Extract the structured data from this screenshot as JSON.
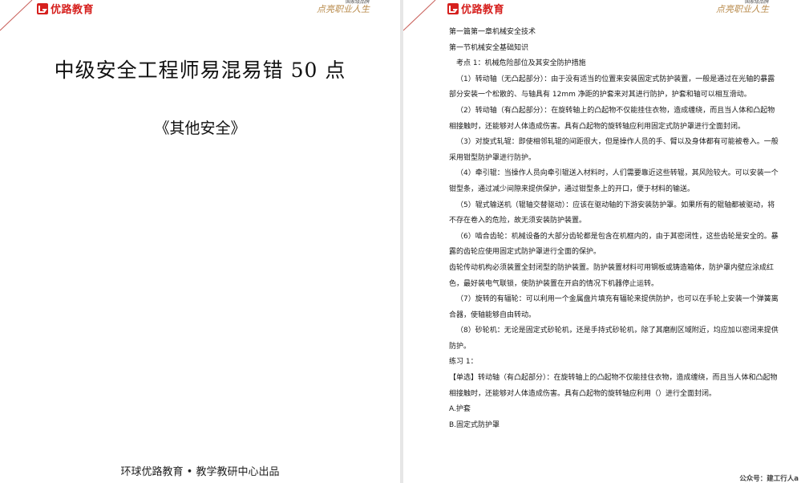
{
  "brand": {
    "logo_text": "优路教育",
    "slogan_small": "国家级品牌",
    "slogan": "点亮职业人生",
    "accent_color": "#d6201e",
    "slogan_color": "#b88a4a"
  },
  "left_page": {
    "title": "中级安全工程师易混易错 50 点",
    "subtitle": "《其他安全》",
    "footer": "环球优路教育 • 教学教研中心出品"
  },
  "right_page": {
    "lines": [
      "第一篇第一章机械安全技术",
      "第一节机械安全基础知识",
      "考点 1：机械危险部位及其安全防护措施",
      "（1）转动轴（无凸起部分）：由于没有适当的位置来安装固定式防护装置，一般是通过在光轴的暴露部分安装一个松散的、与轴具有 12mm 净距的护套来对其进行防护，护套和轴可以相互滑动。",
      "（2）转动轴（有凸起部分）：在旋转轴上的凸起物不仅能挂住衣物，造成缠绕，而且当人体和凸起物相接触时，还能够对人体造成伤害。具有凸起物的旋转轴应利用固定式防护罩进行全面封闭。",
      "（3）对旋式轧辊：即使相邻轧辊的间距很大，但是操作人员的手、臂以及身体都有可能被卷入。一般采用钳型防护罩进行防护。",
      "（4）牵引辊：当操作人员向牵引辊送入材料时，人们需要靠近这些转辊，其风险较大。可以安装一个钳型条，通过减少间隙来提供保护，通过钳型条上的开口，便于材料的输送。",
      "（5）辊式输送机（辊轴交替驱动）：应该在驱动轴的下游安装防护罩。如果所有的辊轴都被驱动，将不存在卷入的危险，故无须安装防护装置。",
      "（6）啮合齿轮：机械设备的大部分齿轮都是包含在机框内的，由于其密闭性，这些齿轮是安全的。暴露的齿轮应使用固定式防护罩进行全面的保护。",
      "齿轮传动机构必须装置全封闭型的防护装置。防护装置材料可用钢板或铸造箱体，防护罩内壁应涂成红色，最好装电气联锁，使防护装置在开启的情况下机器停止运转。",
      "（7）旋转的有辐轮：可以利用一个金属盘片填充有辐轮来提供防护，也可以在手轮上安装一个弹簧离合器，使轴能够自由转动。",
      "（8）砂轮机：无论是固定式砂轮机，还是手持式砂轮机，除了其磨削区域附近，均应加以密闭来提供防护。",
      "练习 1：",
      "【单选】转动轴（有凸起部分）：在旋转轴上的凸起物不仅能挂住衣物，造成缠绕，而且当人体和凸起物相接触时，还能够对人体造成伤害。具有凸起物的旋转轴应利用（）进行全面封闭。",
      "A.护套",
      "B.固定式防护罩"
    ],
    "watermark": "公众号：建工行人a"
  }
}
